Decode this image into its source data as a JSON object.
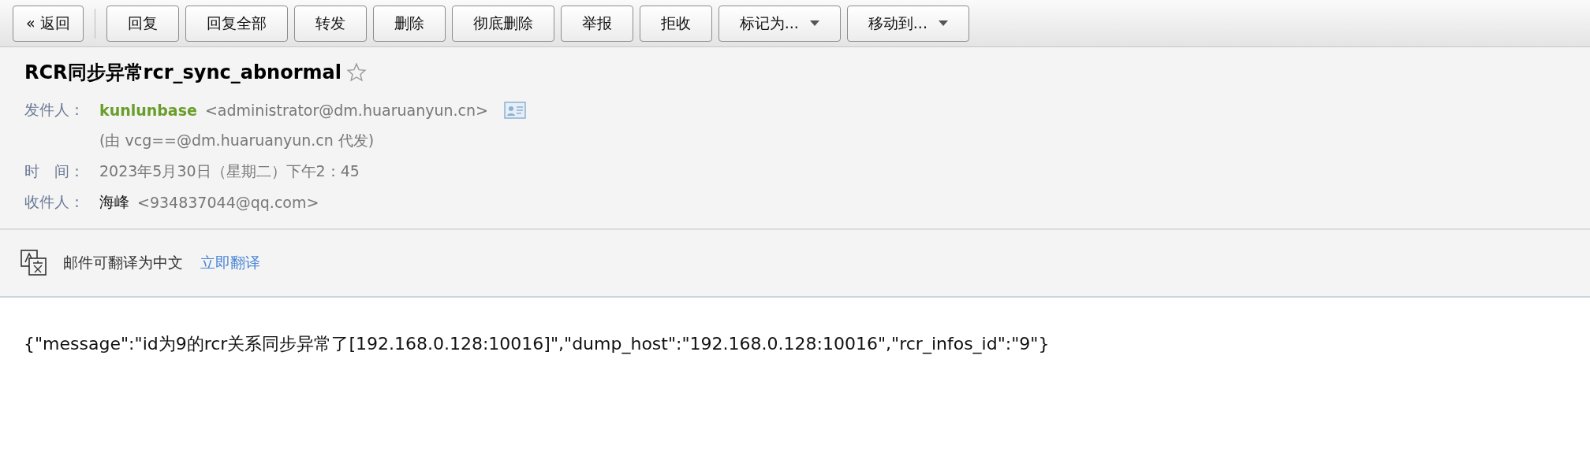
{
  "toolbar": {
    "buttons": [
      {
        "label": "« 返回",
        "kind": "back"
      },
      {
        "label": "回复",
        "kind": "plain"
      },
      {
        "label": "回复全部",
        "kind": "plain"
      },
      {
        "label": "转发",
        "kind": "plain"
      },
      {
        "label": "删除",
        "kind": "plain"
      },
      {
        "label": "彻底删除",
        "kind": "plain"
      },
      {
        "label": "举报",
        "kind": "plain"
      },
      {
        "label": "拒收",
        "kind": "plain"
      },
      {
        "label": "标记为...",
        "kind": "dropdown"
      },
      {
        "label": "移动到...",
        "kind": "dropdown"
      }
    ]
  },
  "header": {
    "subject": "RCR同步异常rcr_sync_abnormal",
    "starred": false,
    "sender": {
      "label": "发件人：",
      "name": "kunlunbase",
      "address": "<administrator@dm.huaruanyun.cn>",
      "via": "(由 vcg==@dm.huaruanyun.cn 代发)"
    },
    "time": {
      "label": "时　间：",
      "value": "2023年5月30日（星期二）下午2：45"
    },
    "recipient": {
      "label": "收件人：",
      "name": "海峰",
      "address": "<934837044@qq.com>"
    }
  },
  "translate_bar": {
    "message": "邮件可翻译为中文",
    "link": "立即翻译"
  },
  "body": "{\"message\":\"id为9的rcr关系同步异常了[192.168.0.128:10016]\",\"dump_host\":\"192.168.0.128:10016\",\"rcr_infos_id\":\"9\"}"
}
